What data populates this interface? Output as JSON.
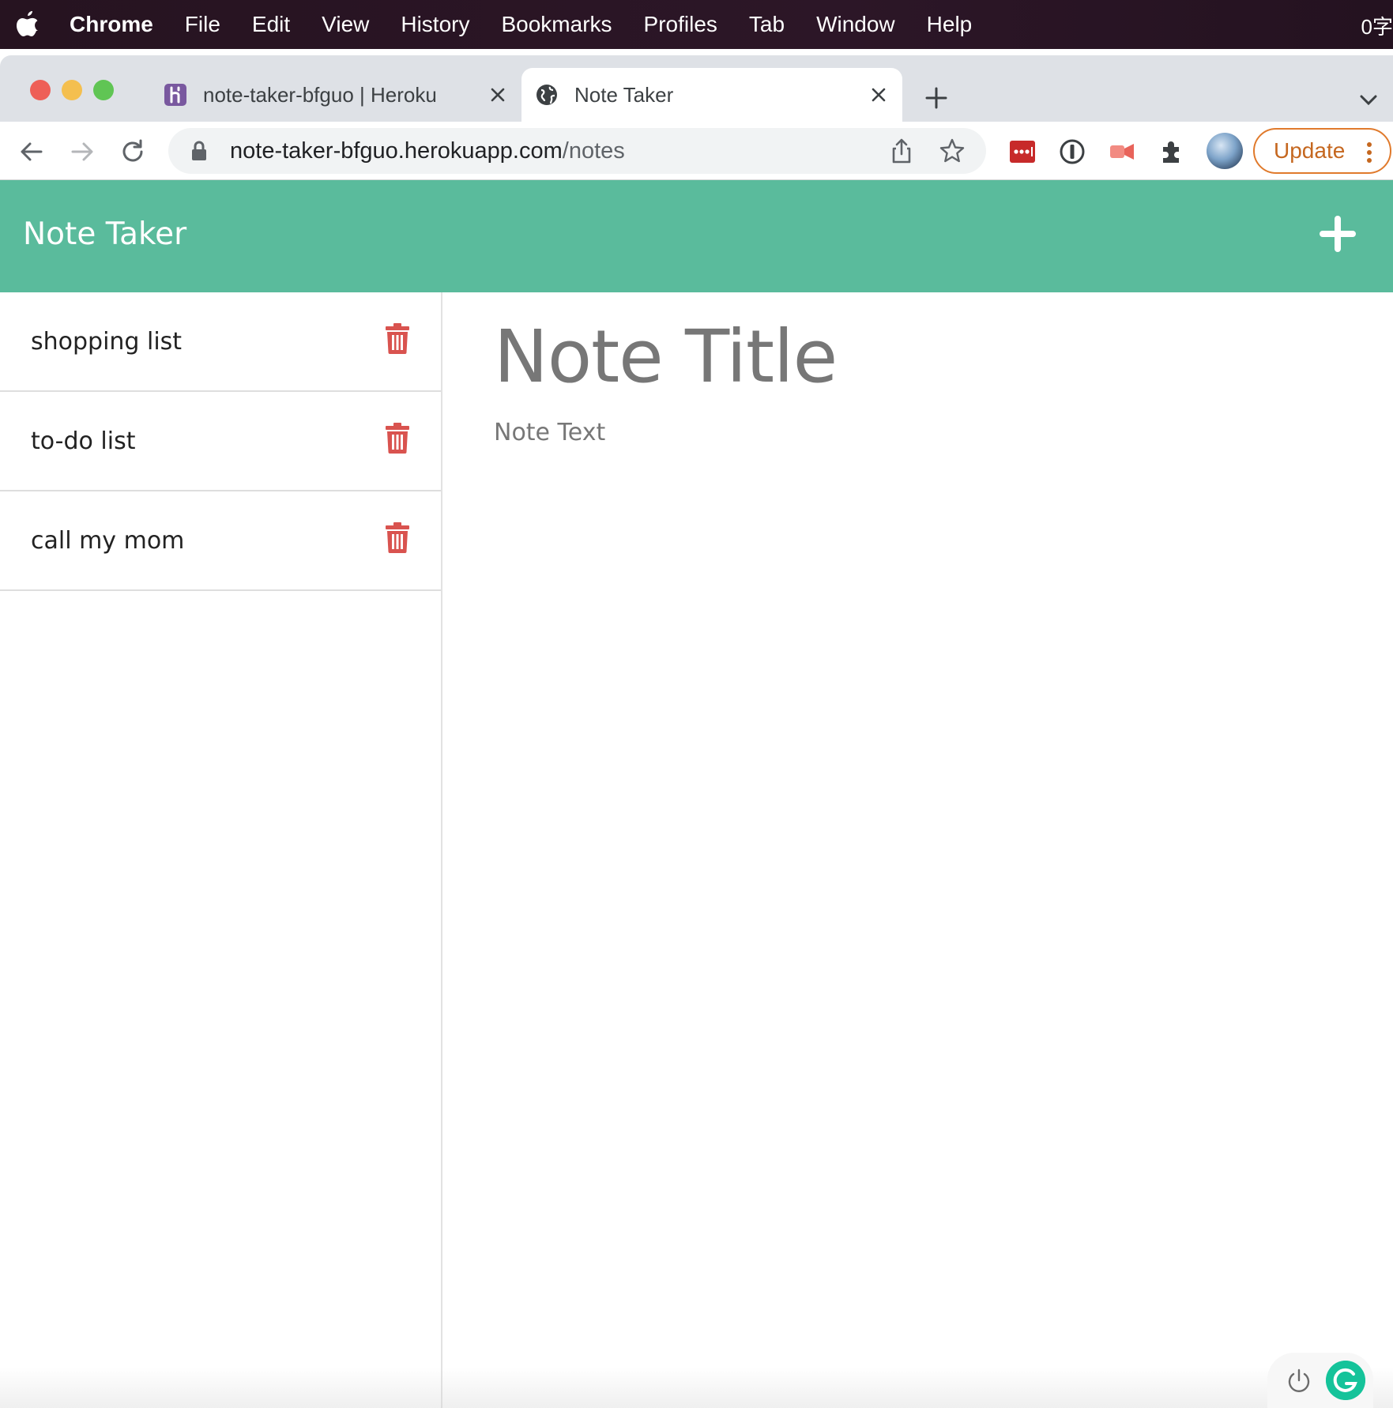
{
  "menubar": {
    "app_name": "Chrome",
    "items": [
      "File",
      "Edit",
      "View",
      "History",
      "Bookmarks",
      "Profiles",
      "Tab",
      "Window",
      "Help"
    ],
    "clock_fragment": "0字"
  },
  "tabs": [
    {
      "title": "note-taker-bfguo | Heroku",
      "favicon": "heroku-icon",
      "active": false
    },
    {
      "title": "Note Taker",
      "favicon": "globe-icon",
      "active": true
    }
  ],
  "toolbar": {
    "url_host": "note-taker-bfguo.herokuapp.com",
    "url_path": "/notes",
    "update_label": "Update"
  },
  "app": {
    "brand": "Note Taker",
    "accent_color": "#5abb9c",
    "notes": [
      {
        "title": "shopping list"
      },
      {
        "title": "to-do list"
      },
      {
        "title": "call my mom"
      }
    ],
    "editor": {
      "title_placeholder": "Note Title",
      "text_placeholder": "Note Text"
    }
  }
}
